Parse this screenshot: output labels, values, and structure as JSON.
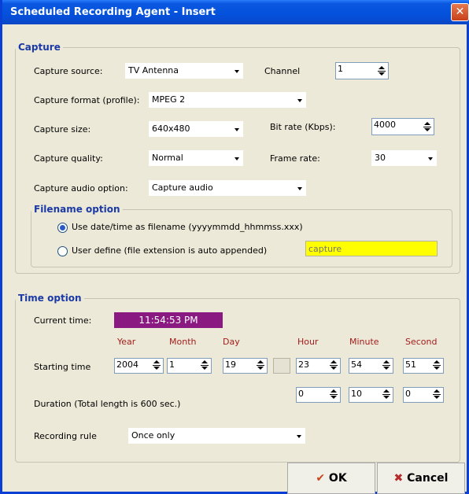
{
  "window": {
    "title": "Scheduled Recording Agent - Insert",
    "close_icon": "close-icon"
  },
  "capture": {
    "legend": "Capture",
    "source_label": "Capture source:",
    "source_value": "TV Antenna",
    "channel_label": "Channel",
    "channel_value": "1",
    "format_label": "Capture format (profile):",
    "format_value": "MPEG 2",
    "size_label": "Capture size:",
    "size_value": "640x480",
    "bitrate_label": "Bit rate (Kbps):",
    "bitrate_value": "4000",
    "quality_label": "Capture quality:",
    "quality_value": "Normal",
    "framerate_label": "Frame rate:",
    "framerate_value": "30",
    "audio_label": "Capture audio option:",
    "audio_value": "Capture audio"
  },
  "filename": {
    "legend": "Filename option",
    "opt_date_label": "Use date/time as filename (yyyymmdd_hhmmss.xxx)",
    "opt_user_label": "User define (file extension is auto appended)",
    "user_placeholder": "capture",
    "selected": "date"
  },
  "time": {
    "legend": "Time option",
    "current_label": "Current time:",
    "current_value": "11:54:53 PM",
    "col_year": "Year",
    "col_month": "Month",
    "col_day": "Day",
    "col_hour": "Hour",
    "col_minute": "Minute",
    "col_second": "Second",
    "start_label": "Starting time",
    "start_year": "2004",
    "start_month": "1",
    "start_day": "19",
    "start_hour": "23",
    "start_minute": "54",
    "start_second": "51",
    "duration_label": "Duration (Total length is 600 sec.)",
    "dur_hour": "0",
    "dur_minute": "10",
    "dur_second": "0",
    "rule_label": "Recording rule",
    "rule_value": "Once only"
  },
  "buttons": {
    "ok_label": "OK",
    "cancel_label": "Cancel"
  },
  "colors": {
    "title_bar": "#0451dc",
    "legend": "#1b3aa5",
    "current_time_bg": "#8a1a82",
    "user_field_bg": "#ffff00",
    "column_header": "#a31d1d",
    "ok_icon": "#c8471c",
    "cancel_icon": "#b52a2a"
  }
}
